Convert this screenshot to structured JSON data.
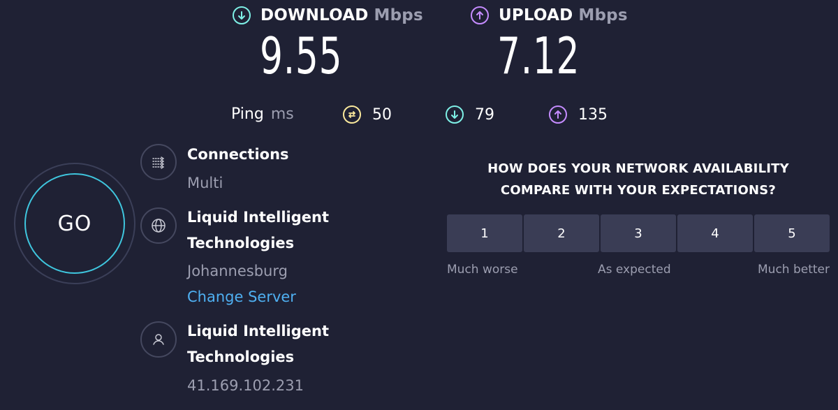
{
  "download": {
    "label": "DOWNLOAD",
    "unit": "Mbps",
    "value": "9.55",
    "color": "#7ef0e6"
  },
  "upload": {
    "label": "UPLOAD",
    "unit": "Mbps",
    "value": "7.12",
    "color": "#c58cff"
  },
  "ping": {
    "label": "Ping",
    "unit": "ms",
    "idle": "50",
    "download": "79",
    "upload": "135"
  },
  "go_button": {
    "label": "GO"
  },
  "connections": {
    "title": "Connections",
    "value": "Multi"
  },
  "server": {
    "name_line1": "Liquid Intelligent",
    "name_line2": "Technologies",
    "location": "Johannesburg",
    "change_link": "Change Server"
  },
  "provider": {
    "name_line1": "Liquid Intelligent",
    "name_line2": "Technologies",
    "ip": "41.169.102.231"
  },
  "survey": {
    "question_line1": "HOW DOES YOUR NETWORK AVAILABILITY",
    "question_line2": "COMPARE WITH YOUR EXPECTATIONS?",
    "options": [
      "1",
      "2",
      "3",
      "4",
      "5"
    ],
    "low_label": "Much worse",
    "mid_label": "As expected",
    "high_label": "Much better"
  },
  "icons": {
    "download": "arrow-down-circle-icon",
    "upload": "arrow-up-circle-icon",
    "ping": "ping-idle-icon",
    "connections": "connections-icon",
    "server": "globe-icon",
    "provider": "user-icon"
  }
}
